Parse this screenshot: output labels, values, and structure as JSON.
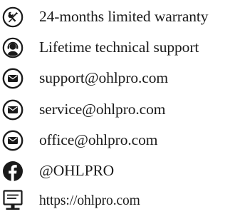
{
  "items": [
    {
      "icon": "tools-icon",
      "text": "24-months limited warranty"
    },
    {
      "icon": "support-agent-icon",
      "text": "Lifetime technical support"
    },
    {
      "icon": "envelope-icon",
      "text": "support@ohlpro.com"
    },
    {
      "icon": "envelope-icon",
      "text": "service@ohlpro.com"
    },
    {
      "icon": "envelope-icon",
      "text": "office@ohlpro.com"
    },
    {
      "icon": "facebook-icon",
      "text": "@OHLPRO"
    },
    {
      "icon": "website-monitor-icon",
      "text": "https://ohlpro.com"
    }
  ],
  "colors": {
    "icon": "#1a1a1a",
    "text": "#1a1a1a",
    "background": "#ffffff"
  }
}
